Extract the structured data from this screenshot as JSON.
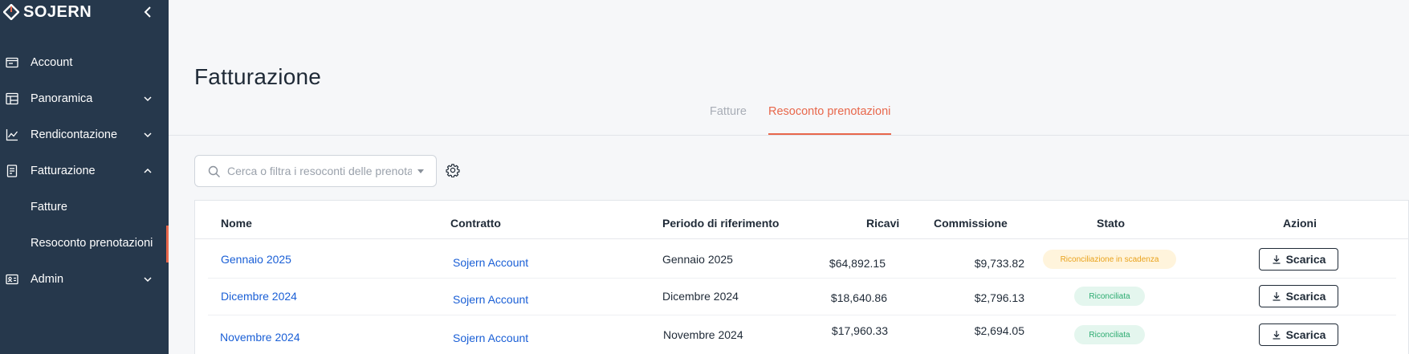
{
  "brand": {
    "name": "SOJERN",
    "accent": "#e8674b",
    "sidebar_bg": "#26384c"
  },
  "sidebar": {
    "collapse_icon": "chevron-left-icon",
    "items": [
      {
        "label": "Account",
        "icon": "account-card-icon"
      },
      {
        "label": "Panoramica",
        "icon": "dashboard-grid-icon",
        "chevron": "chevron-down-icon"
      },
      {
        "label": "Rendicontazione",
        "icon": "line-chart-icon",
        "chevron": "chevron-down-icon"
      },
      {
        "label": "Fatturazione",
        "icon": "receipt-icon",
        "chevron": "chevron-up-icon"
      },
      {
        "label": "Admin",
        "icon": "id-card-icon",
        "chevron": "chevron-down-icon"
      }
    ],
    "subitems": [
      {
        "label": "Fatture"
      },
      {
        "label": "Resoconto prenotazioni",
        "active": true
      }
    ]
  },
  "page": {
    "title": "Fatturazione"
  },
  "tabs": [
    {
      "label": "Fatture",
      "active": false
    },
    {
      "label": "Resoconto prenotazioni",
      "active": true
    }
  ],
  "search": {
    "placeholder": "Cerca o filtra i resoconti delle prenotazioni",
    "value": ""
  },
  "table": {
    "columns": [
      "Nome",
      "Contratto",
      "Periodo di riferimento",
      "Ricavi",
      "Commissione",
      "Stato",
      "Azioni"
    ],
    "rows": [
      {
        "name": "Gennaio 2025",
        "contract": "Sojern Account",
        "period": "Gennaio 2025",
        "revenue": "$64,892.15",
        "commission": "$9,733.82",
        "status": "Riconciliazione in scadenza",
        "status_type": "warn",
        "action": "Scarica"
      },
      {
        "name": "Dicembre 2024",
        "contract": "Sojern Account",
        "period": "Dicembre 2024",
        "revenue": "$18,640.86",
        "commission": "$2,796.13",
        "status": "Riconciliata",
        "status_type": "ok",
        "action": "Scarica"
      },
      {
        "name": "Novembre 2024",
        "contract": "Sojern Account",
        "period": "Novembre 2024",
        "revenue": "$17,960.33",
        "commission": "$2,694.05",
        "status": "Riconciliata",
        "status_type": "ok",
        "action": "Scarica"
      }
    ]
  }
}
